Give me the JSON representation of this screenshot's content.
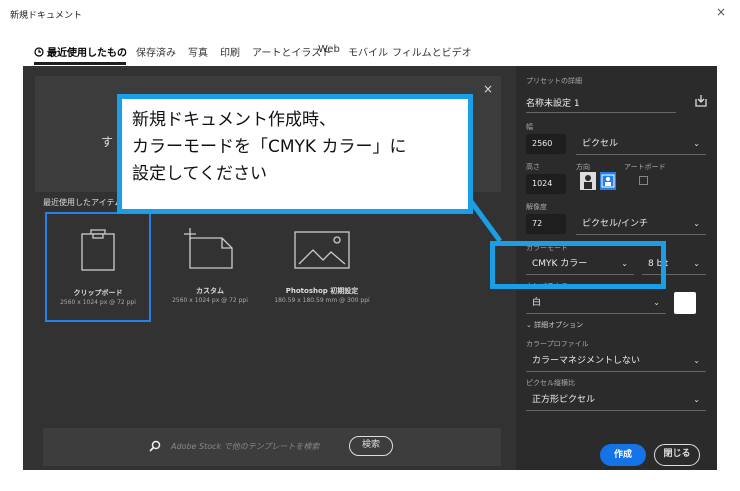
{
  "window": {
    "title": "新規ドキュメント",
    "close_glyph": "×"
  },
  "tabs": [
    {
      "label": "最近使用したもの",
      "active": true
    },
    {
      "label": "保存済み"
    },
    {
      "label": "写真"
    },
    {
      "label": "印刷"
    },
    {
      "label": "アートとイラスト"
    },
    {
      "label": "Web"
    },
    {
      "label": "モバイル"
    },
    {
      "label": "フィルムとビデオ"
    }
  ],
  "blank_panel": {
    "partial_text": "す",
    "close_glyph": "×"
  },
  "recent": {
    "label": "最近使用したアイテム",
    "presets": [
      {
        "name": "クリップボード",
        "dims": "2560 x 1024 px @ 72 ppi",
        "selected": true,
        "icon": "clipboard-icon"
      },
      {
        "name": "カスタム",
        "dims": "2560 x 1024 px @ 72 ppi",
        "selected": false,
        "icon": "custom-document-icon"
      },
      {
        "name": "Photoshop 初期設定",
        "dims": "180.59 x 180.59 mm @ 300 ppi",
        "selected": false,
        "icon": "image-icon"
      }
    ]
  },
  "search": {
    "placeholder": "Adobe Stock で他のテンプレートを検索",
    "button": "検索"
  },
  "details": {
    "header": "プリセットの詳細",
    "name": "名称未設定 1",
    "width_label": "幅",
    "width_value": "2560",
    "width_unit": "ピクセル",
    "height_label": "高さ",
    "height_value": "1024",
    "orientation_label": "方向",
    "artboard_label": "アートボード",
    "resolution_label": "解像度",
    "resolution_value": "72",
    "resolution_unit": "ピクセル/インチ",
    "color_mode_label": "カラーモード",
    "color_mode_value": "CMYK カラー",
    "bit_depth_value": "8 bit",
    "canvas_color_label": "カンバスカラー",
    "canvas_color_value": "白",
    "advanced_label": "詳細オプション",
    "color_profile_label": "カラープロファイル",
    "color_profile_value": "カラーマネジメントしない",
    "pixel_aspect_label": "ピクセル縦横比",
    "pixel_aspect_value": "正方形ピクセル",
    "create_button": "作成",
    "close_button": "閉じる"
  },
  "annotation": {
    "lines": [
      "新規ドキュメント作成時、",
      "カラーモードを「CMYK カラー」に",
      "設定してください"
    ]
  },
  "colors": {
    "accent": "#1473e6",
    "callout": "#1a9ee5",
    "dialog_bg": "#323232",
    "panel_bg": "#2b2b2b"
  }
}
